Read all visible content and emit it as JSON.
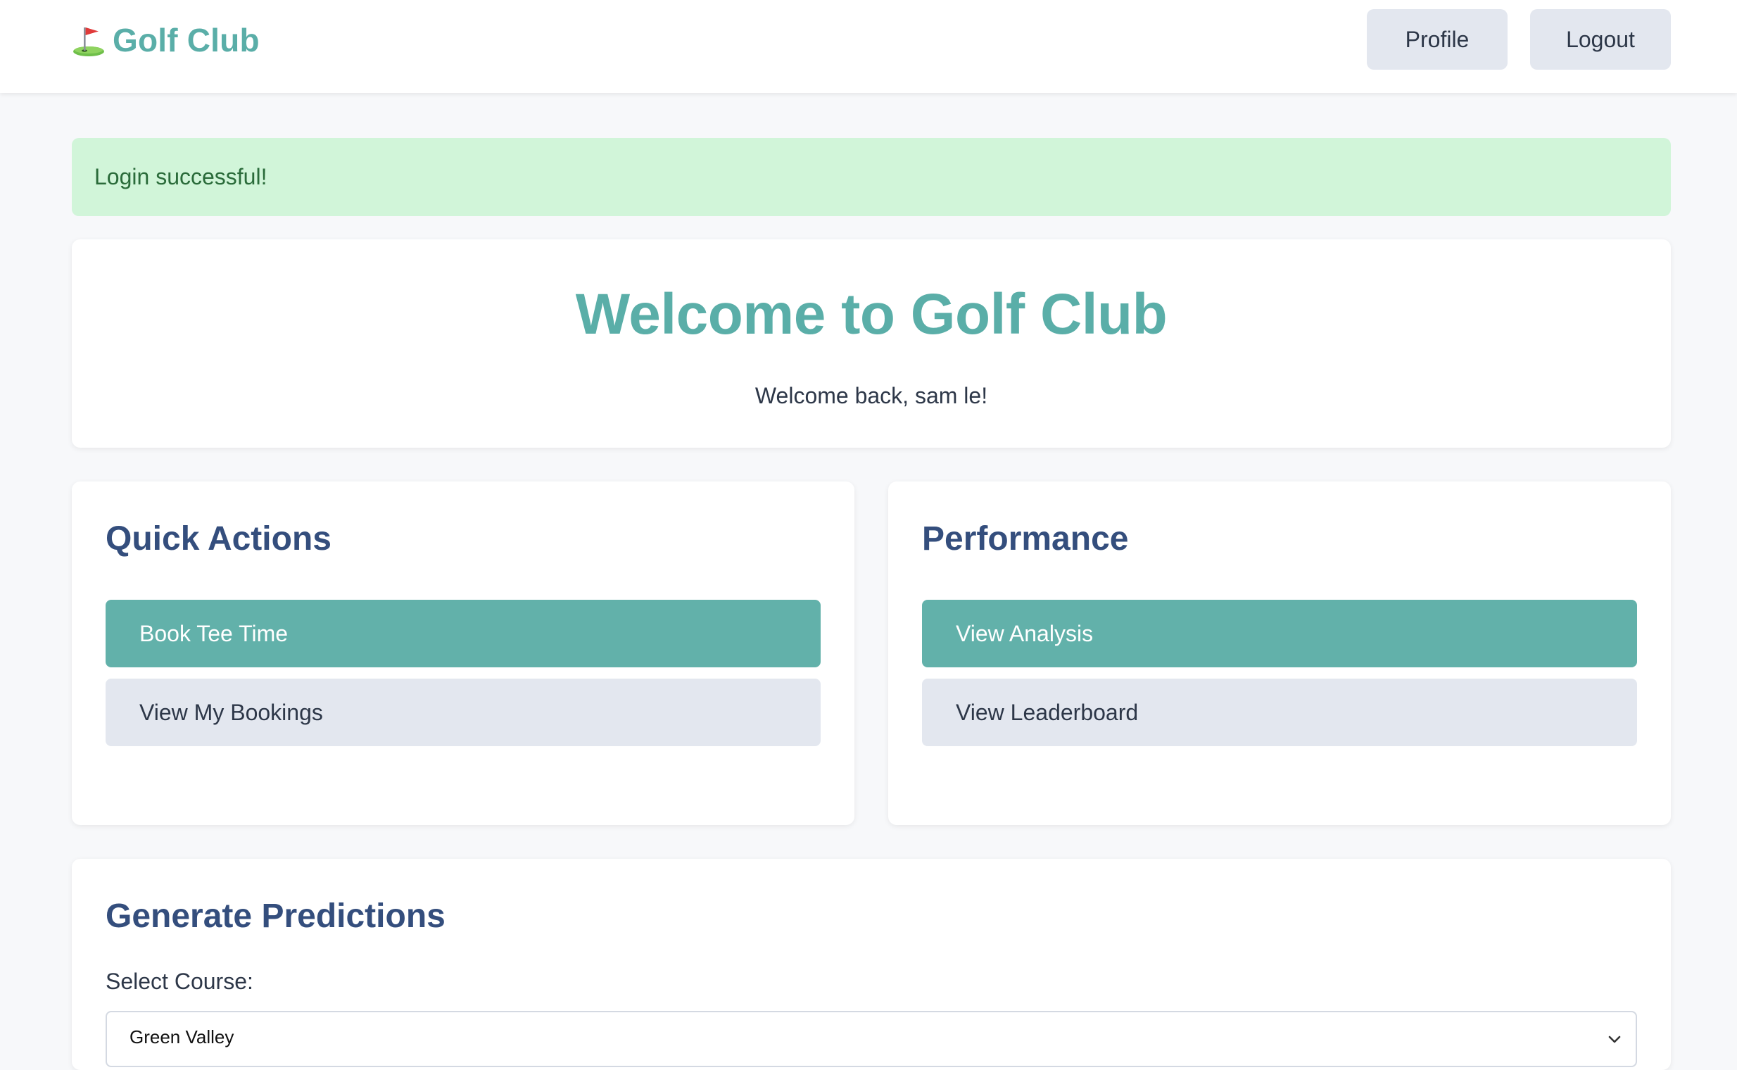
{
  "header": {
    "brand_name": "Golf Club",
    "brand_icon": "golf-flag-icon",
    "profile_label": "Profile",
    "logout_label": "Logout"
  },
  "alert": {
    "message": "Login successful!",
    "color": "#d1f5d9"
  },
  "welcome": {
    "title": "Welcome to Golf Club",
    "message": "Welcome back, sam le!"
  },
  "quick_actions": {
    "heading": "Quick Actions",
    "primary_label": "Book Tee Time",
    "secondary_label": "View My Bookings"
  },
  "performance": {
    "heading": "Performance",
    "primary_label": "View Analysis",
    "secondary_label": "View Leaderboard"
  },
  "predictions": {
    "heading": "Generate Predictions",
    "course_label": "Select Course:",
    "course_selected": "Green Valley"
  },
  "colors": {
    "accent": "#5aaea8",
    "heading": "#344e7d",
    "secondary_button": "#e3e7ef"
  }
}
